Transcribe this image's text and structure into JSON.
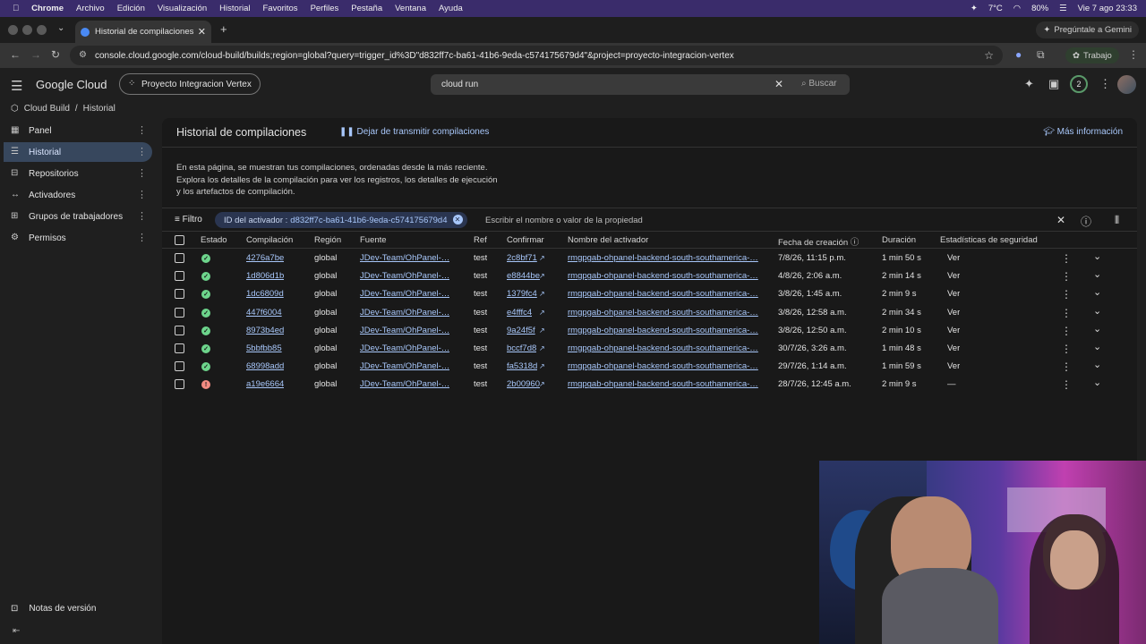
{
  "menubar": {
    "app": "Chrome",
    "items": [
      "Archivo",
      "Edición",
      "Visualización",
      "Historial",
      "Favoritos",
      "Perfiles",
      "Pestaña",
      "Ventana",
      "Ayuda"
    ],
    "battery": "80%",
    "temp": "7°C",
    "datetime": "Vie 7 ago  23:33"
  },
  "browser": {
    "tab_title": "Historial de compilaciones – C",
    "gemini_label": "Pregúntale a Gemini",
    "url": "console.cloud.google.com/cloud-build/builds;region=global?query=trigger_id%3D\"d832ff7c-ba61-41b6-9eda-c574175679d4\"&project=proyecto-integracion-vertex",
    "profile_label": "Trabajo"
  },
  "header": {
    "brand": "Google Cloud",
    "project": "Proyecto Integracion Vertex",
    "search_value": "cloud run",
    "search_button": "Buscar",
    "notifications": "2"
  },
  "breadcrumb": {
    "service": "Cloud Build",
    "separator": "/",
    "page": "Historial"
  },
  "sidebar": {
    "items": [
      {
        "label": "Panel",
        "icon": "dashboard-icon"
      },
      {
        "label": "Historial",
        "icon": "list-icon"
      },
      {
        "label": "Repositorios",
        "icon": "repo-icon"
      },
      {
        "label": "Activadores",
        "icon": "trigger-icon"
      },
      {
        "label": "Grupos de trabajadores",
        "icon": "workers-icon"
      },
      {
        "label": "Permisos",
        "icon": "gear-icon"
      }
    ],
    "release_notes": "Notas de versión"
  },
  "main": {
    "title": "Historial de compilaciones",
    "stream_action": "Dejar de transmitir compilaciones",
    "more_info": "Más información",
    "description": "En esta página, se muestran tus compilaciones, ordenadas desde la más reciente. Explora los detalles de la compilación para ver los registros, los detalles de ejecución y los artefactos de compilación.",
    "filter_label": "Filtro",
    "chip_key": "ID del activador :",
    "chip_value": "d832ff7c-ba61-41b6-9eda-c574175679d4",
    "filter_placeholder": "Escribir el nombre o valor de la propiedad"
  },
  "table": {
    "columns": [
      "Estado",
      "Compilación",
      "Región",
      "Fuente",
      "Ref",
      "Confirmar",
      "Nombre del activador",
      "Fecha de creación",
      "Duración",
      "Estadísticas de seguridad"
    ],
    "rows": [
      {
        "status": "success",
        "build": "4276a7be",
        "region": "global",
        "source": "JDev-Team/OhPanel-…",
        "ref": "test",
        "commit": "2c8bf71",
        "trigger": "rmgpgab-ohpanel-backend-south-southamerica-…",
        "created": "7/8/26, 11:15 p.m.",
        "duration": "1 min 50 s",
        "security": "Ver"
      },
      {
        "status": "success",
        "build": "1d806d1b",
        "region": "global",
        "source": "JDev-Team/OhPanel-…",
        "ref": "test",
        "commit": "e8844be",
        "trigger": "rmgpgab-ohpanel-backend-south-southamerica-…",
        "created": "4/8/26, 2:06 a.m.",
        "duration": "2 min 14 s",
        "security": "Ver"
      },
      {
        "status": "success",
        "build": "1dc6809d",
        "region": "global",
        "source": "JDev-Team/OhPanel-…",
        "ref": "test",
        "commit": "1379fc4",
        "trigger": "rmgpgab-ohpanel-backend-south-southamerica-…",
        "created": "3/8/26, 1:45 a.m.",
        "duration": "2 min 9 s",
        "security": "Ver"
      },
      {
        "status": "success",
        "build": "447f6004",
        "region": "global",
        "source": "JDev-Team/OhPanel-…",
        "ref": "test",
        "commit": "e4fffc4",
        "trigger": "rmgpgab-ohpanel-backend-south-southamerica-…",
        "created": "3/8/26, 12:58 a.m.",
        "duration": "2 min 34 s",
        "security": "Ver"
      },
      {
        "status": "success",
        "build": "8973b4ed",
        "region": "global",
        "source": "JDev-Team/OhPanel-…",
        "ref": "test",
        "commit": "9a24f5f",
        "trigger": "rmgpgab-ohpanel-backend-south-southamerica-…",
        "created": "3/8/26, 12:50 a.m.",
        "duration": "2 min 10 s",
        "security": "Ver"
      },
      {
        "status": "success",
        "build": "5bbfbb85",
        "region": "global",
        "source": "JDev-Team/OhPanel-…",
        "ref": "test",
        "commit": "bccf7d8",
        "trigger": "rmgpgab-ohpanel-backend-south-southamerica-…",
        "created": "30/7/26, 3:26 a.m.",
        "duration": "1 min 48 s",
        "security": "Ver"
      },
      {
        "status": "success",
        "build": "68998add",
        "region": "global",
        "source": "JDev-Team/OhPanel-…",
        "ref": "test",
        "commit": "fa5318d",
        "trigger": "rmgpgab-ohpanel-backend-south-southamerica-…",
        "created": "29/7/26, 1:14 a.m.",
        "duration": "1 min 59 s",
        "security": "Ver"
      },
      {
        "status": "error",
        "build": "a19e6664",
        "region": "global",
        "source": "JDev-Team/OhPanel-…",
        "ref": "test",
        "commit": "2b00960",
        "trigger": "rmgpgab-ohpanel-backend-south-southamerica-…",
        "created": "28/7/26, 12:45 a.m.",
        "duration": "2 min 9 s",
        "security": "—"
      }
    ]
  },
  "colors": {
    "link": "#a8c7fa",
    "success": "#6dd58c",
    "error": "#f28b82",
    "active_nav": "#37475d"
  }
}
